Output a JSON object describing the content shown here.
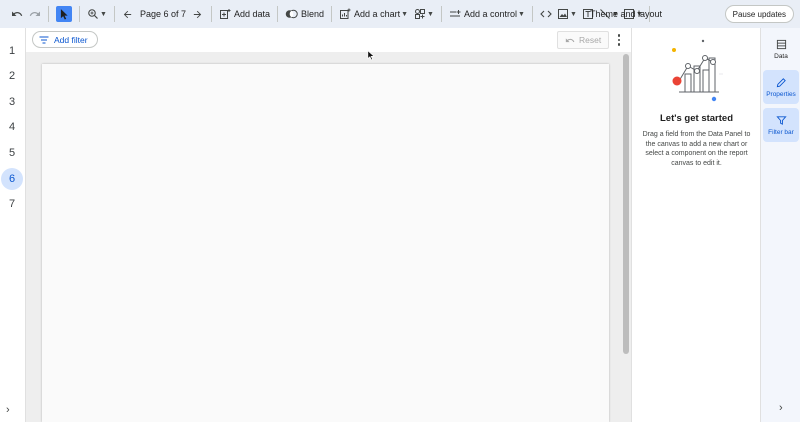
{
  "toolbar": {
    "page_indicator": "Page 6 of 7",
    "add_data_label": "Add data",
    "blend_label": "Blend",
    "add_chart_label": "Add a chart",
    "add_control_label": "Add a control",
    "theme_label": "Theme and layout",
    "pause_label": "Pause updates"
  },
  "pages": [
    "1",
    "2",
    "3",
    "4",
    "5",
    "6",
    "7"
  ],
  "active_page": "6",
  "canvas": {
    "add_filter_label": "Add filter",
    "reset_label": "Reset"
  },
  "panel": {
    "title": "Let's get started",
    "description": "Drag a field from the Data Panel to the canvas to add a new chart or select a component on the report canvas to edit it."
  },
  "rail": {
    "data_label": "Data",
    "properties_label": "Properties",
    "filter_bar_label": "Filter bar"
  },
  "colors": {
    "accent": "#0b57d0",
    "active_bg": "#d3e3fd",
    "select_tool": "#4285f4"
  }
}
